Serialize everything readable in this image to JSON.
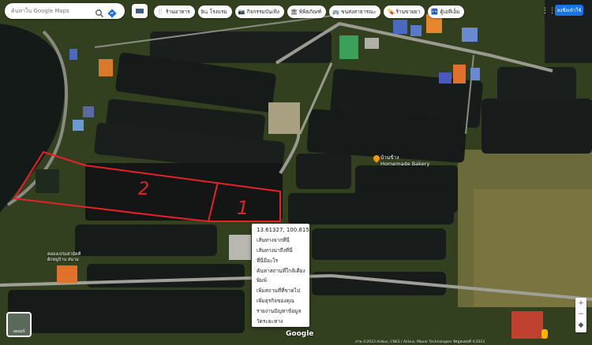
{
  "search": {
    "placeholder": "ค้นหาใน Google Maps"
  },
  "chips": [
    {
      "icon": "restaurant-icon",
      "label": "ร้านอาหาร",
      "glyph": "🍴"
    },
    {
      "icon": "hotel-icon",
      "label": "โรงแรม",
      "glyph": "🛏"
    },
    {
      "icon": "attractions-icon",
      "label": "กิจกรรมบันเทิง",
      "glyph": "📷"
    },
    {
      "icon": "museum-icon",
      "label": "พิพิธภัณฑ์",
      "glyph": "🏛"
    },
    {
      "icon": "transit-icon",
      "label": "ขนส่งสาธารณะ",
      "glyph": "🚌"
    },
    {
      "icon": "pharmacy-icon",
      "label": "ร้านขายยา",
      "glyph": "💊"
    },
    {
      "icon": "atm-icon",
      "label": "ตู้เอทีเอ็ม",
      "glyph": "🏧"
    }
  ],
  "header": {
    "signin_label": "ลงชื่อเข้าใช้"
  },
  "context_menu": {
    "coords": "13.61327, 100.81587",
    "items": [
      "เส้นทางจากที่นี่",
      "เส้นทางมาถึงที่นี่",
      "ที่นี่มีอะไร",
      "ค้นหาสถานที่ใกล้เคียง",
      "พิมพ์",
      "เพิ่มสถานที่ที่ขาดไป",
      "เพิ่มธุรกิจของคุณ",
      "รายงานปัญหาข้อมูล",
      "วัดระยะทาง"
    ]
  },
  "place": {
    "line1": "บ้านข้าง",
    "line2": "Homemade Bakery"
  },
  "poi_small": {
    "line1": "คลองเปรมสามัคคี",
    "line2": "ผักหมู่บ้าน สนาม"
  },
  "annotations": {
    "plot_1": "1",
    "plot_2": "2"
  },
  "layer_switch": {
    "label": "เลเยอร์"
  },
  "footer": {
    "logo": "Google",
    "attribution": "ภาพ ©2023 Airbus, CNES / Airbus, Maxar Technologies ข้อมูลแผนที่ ©2023"
  },
  "colors": {
    "accent": "#1a73e8",
    "plot_outline": "#e8202a",
    "water": "#15181a"
  }
}
